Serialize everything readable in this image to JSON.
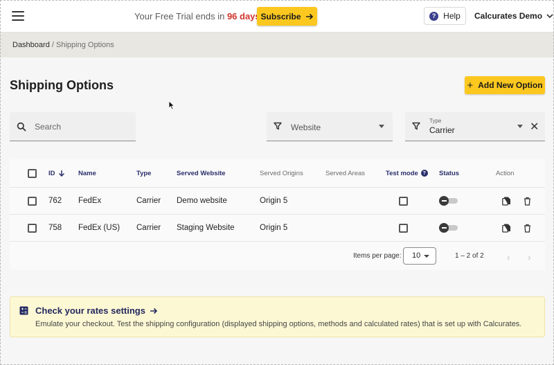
{
  "topbar": {
    "trial_prefix": "Your Free Trial ends in",
    "trial_days": "96 days",
    "subscribe_label": "Subscribe",
    "help_label": "Help",
    "account_name": "Calcurates Demo"
  },
  "breadcrumb": {
    "root": "Dashboard",
    "separator": "/",
    "current": "Shipping Options"
  },
  "page": {
    "title": "Shipping Options",
    "add_button_label": "Add New Option"
  },
  "filters": {
    "search_placeholder": "Search",
    "website_label": "Website",
    "type_label": "Type",
    "type_value": "Carrier"
  },
  "table": {
    "columns": {
      "id": "ID",
      "name": "Name",
      "type": "Type",
      "served_website": "Served Website",
      "served_origins": "Served Origins",
      "served_areas": "Served Areas",
      "test_mode": "Test mode",
      "status": "Status",
      "action": "Action"
    },
    "rows": [
      {
        "id": "762",
        "name": "FedEx",
        "type": "Carrier",
        "served_website": "Demo website",
        "served_origins": "Origin 5",
        "served_areas": ""
      },
      {
        "id": "758",
        "name": "FedEx (US)",
        "type": "Carrier",
        "served_website": "Staging Website",
        "served_origins": "Origin 5",
        "served_areas": ""
      }
    ]
  },
  "paginator": {
    "items_per_page_label": "Items per page:",
    "items_per_page_value": "10",
    "range_label": "1 – 2 of 2"
  },
  "banner": {
    "title": "Check your rates settings",
    "text": "Emulate your checkout. Test the shipping configuration (displayed shipping options, methods and calculated rates) that is set up with Calcurates."
  },
  "colors": {
    "accent_yellow": "#fcc81f",
    "navy": "#2a2f6a",
    "trial_red": "#d0342c",
    "banner_bg": "#fdf8d4"
  },
  "icons": [
    "menu-icon",
    "arrow-right-icon",
    "help-icon",
    "chevron-down-icon",
    "plus-icon",
    "search-icon",
    "filter-icon",
    "close-icon",
    "arrow-down-icon",
    "info-icon",
    "copy-icon",
    "delete-icon",
    "chevron-left-icon",
    "chevron-right-icon",
    "calculator-icon"
  ]
}
